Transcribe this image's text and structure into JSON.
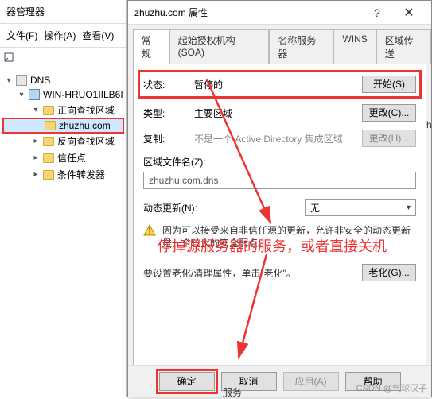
{
  "back_window": {
    "title_fragment": "器管理器",
    "menu": {
      "file": "文件(F)",
      "action": "操作(A)",
      "view": "查看(V)"
    },
    "tree": {
      "root": "DNS",
      "server": "WIN-HRUO1IILB6I",
      "forward": "正向查找区域",
      "zone": "zhuzhu.com",
      "reverse": "反向查找区域",
      "trust": "信任点",
      "cond": "条件转发器"
    }
  },
  "dialog": {
    "title": "zhuzhu.com 属性",
    "tabs": [
      "常规",
      "起始授权机构(SOA)",
      "名称服务器",
      "WINS",
      "区域传送"
    ],
    "status_label": "状态:",
    "status_value": "暂停的",
    "start_btn": "开始(S)",
    "type_label": "类型:",
    "type_value": "主要区域",
    "change_btn": "更改(C)...",
    "repl_label": "复制:",
    "repl_value": "不是一个 Active Directory 集成区域",
    "change_btn2": "更改(H)...",
    "zonefile_label": "区域文件名(Z):",
    "zonefile_value": "zhuzhu.com.dns",
    "dyn_label": "动态更新(N):",
    "dyn_value": "无",
    "warn_text": "因为可以接受来自非信任源的更新，允许非安全的动态更新是一个较大的安全弱点。",
    "aging_text": "要设置老化/清理属性，单击\"老化\"。",
    "aging_btn": "老化(G)...",
    "ok": "确定",
    "cancel": "取消",
    "apply": "应用(A)",
    "help": "帮助"
  },
  "annotation": "停掉源服务器的服务，或者直接关机",
  "watermark": "CSDN @气球汉子",
  "bottom_label": "服务",
  "stray": "h"
}
